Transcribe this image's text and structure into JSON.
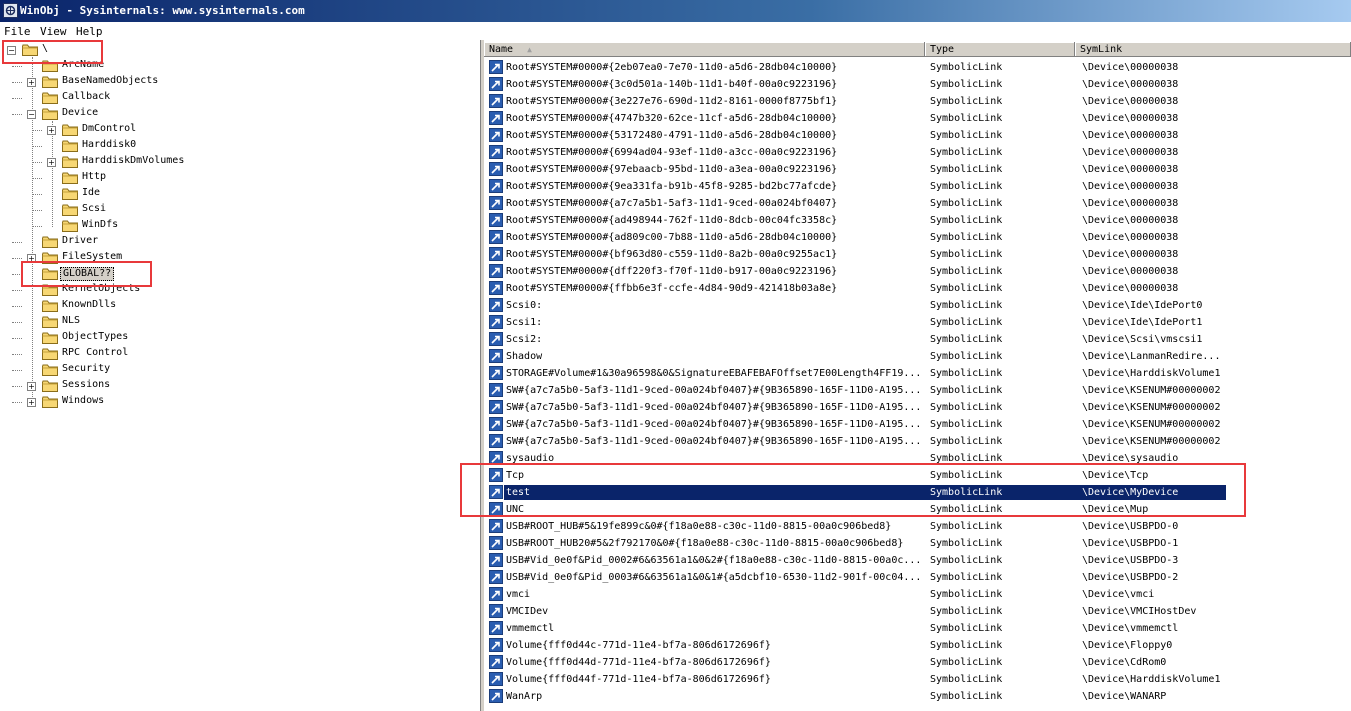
{
  "window": {
    "title": "WinObj - Sysinternals: www.sysinternals.com"
  },
  "menu": [
    {
      "label": "File"
    },
    {
      "label": "View"
    },
    {
      "label": "Help"
    }
  ],
  "tree": {
    "nodes": [
      {
        "label": "\\",
        "expander": "−",
        "depth": 0
      },
      {
        "label": "ArcName",
        "expander": "",
        "depth": 1
      },
      {
        "label": "BaseNamedObjects",
        "expander": "+",
        "depth": 1
      },
      {
        "label": "Callback",
        "expander": "",
        "depth": 1
      },
      {
        "label": "Device",
        "expander": "−",
        "depth": 1
      },
      {
        "label": "DmControl",
        "expander": "+",
        "depth": 2
      },
      {
        "label": "Harddisk0",
        "expander": "",
        "depth": 2
      },
      {
        "label": "HarddiskDmVolumes",
        "expander": "+",
        "depth": 2
      },
      {
        "label": "Http",
        "expander": "",
        "depth": 2
      },
      {
        "label": "Ide",
        "expander": "",
        "depth": 2
      },
      {
        "label": "Scsi",
        "expander": "",
        "depth": 2
      },
      {
        "label": "WinDfs",
        "expander": "",
        "depth": 2
      },
      {
        "label": "Driver",
        "expander": "",
        "depth": 1
      },
      {
        "label": "FileSystem",
        "expander": "+",
        "depth": 1
      },
      {
        "label": "GLOBAL??",
        "expander": "",
        "depth": 1,
        "selected": true
      },
      {
        "label": "KernelObjects",
        "expander": "",
        "depth": 1
      },
      {
        "label": "KnownDlls",
        "expander": "",
        "depth": 1
      },
      {
        "label": "NLS",
        "expander": "",
        "depth": 1
      },
      {
        "label": "ObjectTypes",
        "expander": "",
        "depth": 1
      },
      {
        "label": "RPC Control",
        "expander": "",
        "depth": 1
      },
      {
        "label": "Security",
        "expander": "",
        "depth": 1
      },
      {
        "label": "Sessions",
        "expander": "+",
        "depth": 1
      },
      {
        "label": "Windows",
        "expander": "+",
        "depth": 1
      }
    ]
  },
  "list": {
    "columns": {
      "name": "Name",
      "sort_glyph": "▲",
      "type": "Type",
      "symlink": "SymLink"
    },
    "rows": [
      {
        "name": "Root#SYSTEM#0000#{2eb07ea0-7e70-11d0-a5d6-28db04c10000}",
        "type": "SymbolicLink",
        "link": "\\Device\\00000038"
      },
      {
        "name": "Root#SYSTEM#0000#{3c0d501a-140b-11d1-b40f-00a0c9223196}",
        "type": "SymbolicLink",
        "link": "\\Device\\00000038"
      },
      {
        "name": "Root#SYSTEM#0000#{3e227e76-690d-11d2-8161-0000f8775bf1}",
        "type": "SymbolicLink",
        "link": "\\Device\\00000038"
      },
      {
        "name": "Root#SYSTEM#0000#{4747b320-62ce-11cf-a5d6-28db04c10000}",
        "type": "SymbolicLink",
        "link": "\\Device\\00000038"
      },
      {
        "name": "Root#SYSTEM#0000#{53172480-4791-11d0-a5d6-28db04c10000}",
        "type": "SymbolicLink",
        "link": "\\Device\\00000038"
      },
      {
        "name": "Root#SYSTEM#0000#{6994ad04-93ef-11d0-a3cc-00a0c9223196}",
        "type": "SymbolicLink",
        "link": "\\Device\\00000038"
      },
      {
        "name": "Root#SYSTEM#0000#{97ebaacb-95bd-11d0-a3ea-00a0c9223196}",
        "type": "SymbolicLink",
        "link": "\\Device\\00000038"
      },
      {
        "name": "Root#SYSTEM#0000#{9ea331fa-b91b-45f8-9285-bd2bc77afcde}",
        "type": "SymbolicLink",
        "link": "\\Device\\00000038"
      },
      {
        "name": "Root#SYSTEM#0000#{a7c7a5b1-5af3-11d1-9ced-00a024bf0407}",
        "type": "SymbolicLink",
        "link": "\\Device\\00000038"
      },
      {
        "name": "Root#SYSTEM#0000#{ad498944-762f-11d0-8dcb-00c04fc3358c}",
        "type": "SymbolicLink",
        "link": "\\Device\\00000038"
      },
      {
        "name": "Root#SYSTEM#0000#{ad809c00-7b88-11d0-a5d6-28db04c10000}",
        "type": "SymbolicLink",
        "link": "\\Device\\00000038"
      },
      {
        "name": "Root#SYSTEM#0000#{bf963d80-c559-11d0-8a2b-00a0c9255ac1}",
        "type": "SymbolicLink",
        "link": "\\Device\\00000038"
      },
      {
        "name": "Root#SYSTEM#0000#{dff220f3-f70f-11d0-b917-00a0c9223196}",
        "type": "SymbolicLink",
        "link": "\\Device\\00000038"
      },
      {
        "name": "Root#SYSTEM#0000#{ffbb6e3f-ccfe-4d84-90d9-421418b03a8e}",
        "type": "SymbolicLink",
        "link": "\\Device\\00000038"
      },
      {
        "name": "Scsi0:",
        "type": "SymbolicLink",
        "link": "\\Device\\Ide\\IdePort0"
      },
      {
        "name": "Scsi1:",
        "type": "SymbolicLink",
        "link": "\\Device\\Ide\\IdePort1"
      },
      {
        "name": "Scsi2:",
        "type": "SymbolicLink",
        "link": "\\Device\\Scsi\\vmscsi1"
      },
      {
        "name": "Shadow",
        "type": "SymbolicLink",
        "link": "\\Device\\LanmanRedire..."
      },
      {
        "name": "STORAGE#Volume#1&30a96598&0&SignatureEBAFEBAFOffset7E00Length4FF19...",
        "type": "SymbolicLink",
        "link": "\\Device\\HarddiskVolume1"
      },
      {
        "name": "SW#{a7c7a5b0-5af3-11d1-9ced-00a024bf0407}#{9B365890-165F-11D0-A195...",
        "type": "SymbolicLink",
        "link": "\\Device\\KSENUM#00000002"
      },
      {
        "name": "SW#{a7c7a5b0-5af3-11d1-9ced-00a024bf0407}#{9B365890-165F-11D0-A195...",
        "type": "SymbolicLink",
        "link": "\\Device\\KSENUM#00000002"
      },
      {
        "name": "SW#{a7c7a5b0-5af3-11d1-9ced-00a024bf0407}#{9B365890-165F-11D0-A195...",
        "type": "SymbolicLink",
        "link": "\\Device\\KSENUM#00000002"
      },
      {
        "name": "SW#{a7c7a5b0-5af3-11d1-9ced-00a024bf0407}#{9B365890-165F-11D0-A195...",
        "type": "SymbolicLink",
        "link": "\\Device\\KSENUM#00000002"
      },
      {
        "name": "sysaudio",
        "type": "SymbolicLink",
        "link": "\\Device\\sysaudio"
      },
      {
        "name": "Tcp",
        "type": "SymbolicLink",
        "link": "\\Device\\Tcp"
      },
      {
        "name": "test",
        "type": "SymbolicLink",
        "link": "\\Device\\MyDevice",
        "selected": true
      },
      {
        "name": "UNC",
        "type": "SymbolicLink",
        "link": "\\Device\\Mup"
      },
      {
        "name": "USB#ROOT_HUB#5&19fe899c&0#{f18a0e88-c30c-11d0-8815-00a0c906bed8}",
        "type": "SymbolicLink",
        "link": "\\Device\\USBPDO-0"
      },
      {
        "name": "USB#ROOT_HUB20#5&2f792170&0#{f18a0e88-c30c-11d0-8815-00a0c906bed8}",
        "type": "SymbolicLink",
        "link": "\\Device\\USBPDO-1"
      },
      {
        "name": "USB#Vid_0e0f&Pid_0002#6&63561a1&0&2#{f18a0e88-c30c-11d0-8815-00a0c...",
        "type": "SymbolicLink",
        "link": "\\Device\\USBPDO-3"
      },
      {
        "name": "USB#Vid_0e0f&Pid_0003#6&63561a1&0&1#{a5dcbf10-6530-11d2-901f-00c04...",
        "type": "SymbolicLink",
        "link": "\\Device\\USBPDO-2"
      },
      {
        "name": "vmci",
        "type": "SymbolicLink",
        "link": "\\Device\\vmci"
      },
      {
        "name": "VMCIDev",
        "type": "SymbolicLink",
        "link": "\\Device\\VMCIHostDev"
      },
      {
        "name": "vmmemctl",
        "type": "SymbolicLink",
        "link": "\\Device\\vmmemctl"
      },
      {
        "name": "Volume{fff0d44c-771d-11e4-bf7a-806d6172696f}",
        "type": "SymbolicLink",
        "link": "\\Device\\Floppy0"
      },
      {
        "name": "Volume{fff0d44d-771d-11e4-bf7a-806d6172696f}",
        "type": "SymbolicLink",
        "link": "\\Device\\CdRom0"
      },
      {
        "name": "Volume{fff0d44f-771d-11e4-bf7a-806d6172696f}",
        "type": "SymbolicLink",
        "link": "\\Device\\HarddiskVolume1"
      },
      {
        "name": "WanArp",
        "type": "SymbolicLink",
        "link": "\\Device\\WANARP"
      }
    ]
  },
  "colors": {
    "annotation": "#e8393b",
    "selection": "#0a246a",
    "folder": "#f7d774"
  }
}
